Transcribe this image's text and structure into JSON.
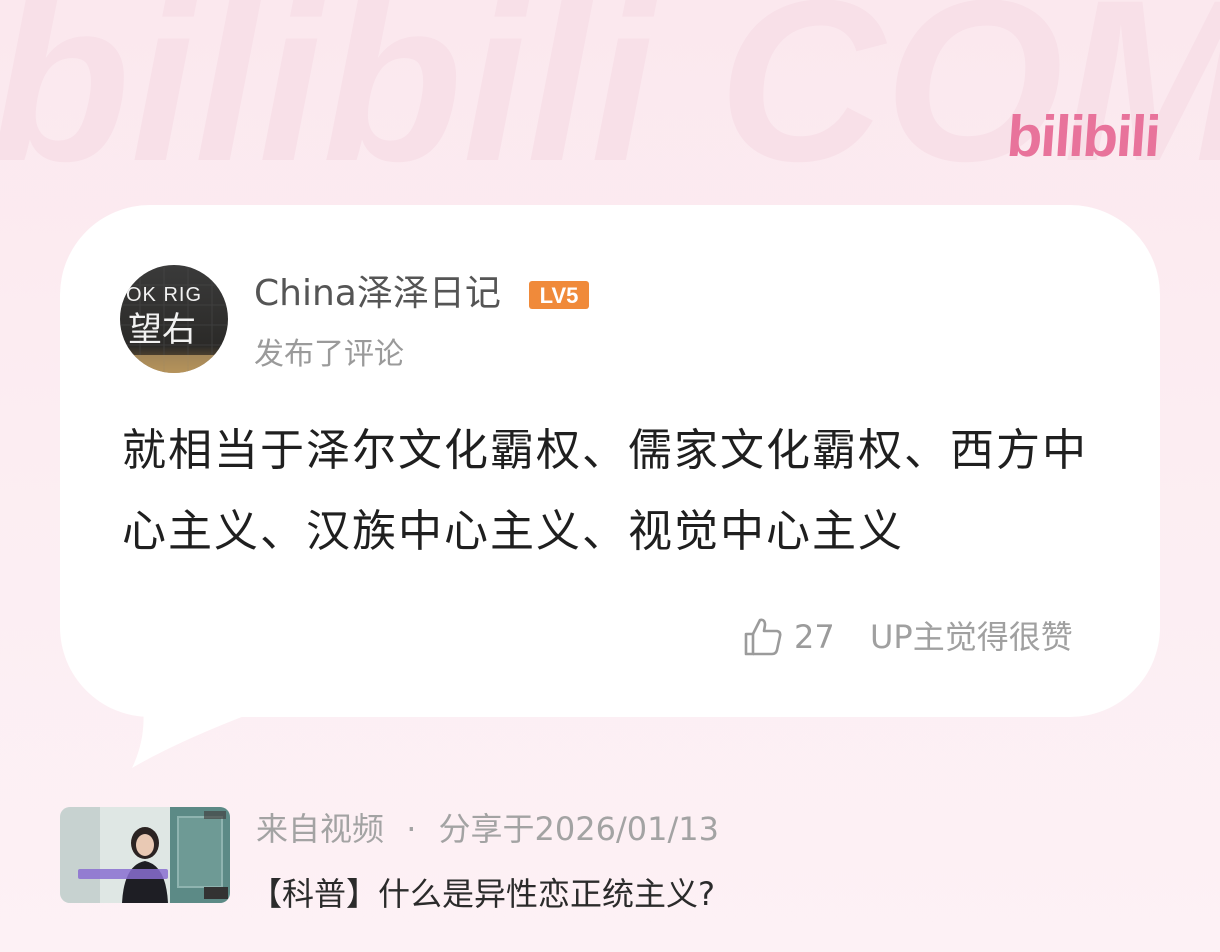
{
  "user": {
    "name": "China泽泽日记",
    "level": "LV5",
    "action": "发布了评论",
    "avatar_text_top": "OK RIG",
    "avatar_text_bottom": "望右"
  },
  "comment": {
    "text": "就相当于泽尔文化霸权、儒家文化霸权、西方中心主义、汉族中心主义、视觉中心主义"
  },
  "stats": {
    "like_count": "27",
    "up_liked_label": "UP主觉得很赞"
  },
  "source": {
    "from_label": "来自视频",
    "separator": "·",
    "shared_at": "分享于2026/01/13",
    "video_title": "【科普】什么是异性恋正统主义?"
  },
  "brand": {
    "logo_text": "bilibili",
    "watermark_text": "bilibili COMMENT",
    "accent_color": "#e8739b",
    "level_color": "#f08a3a"
  }
}
